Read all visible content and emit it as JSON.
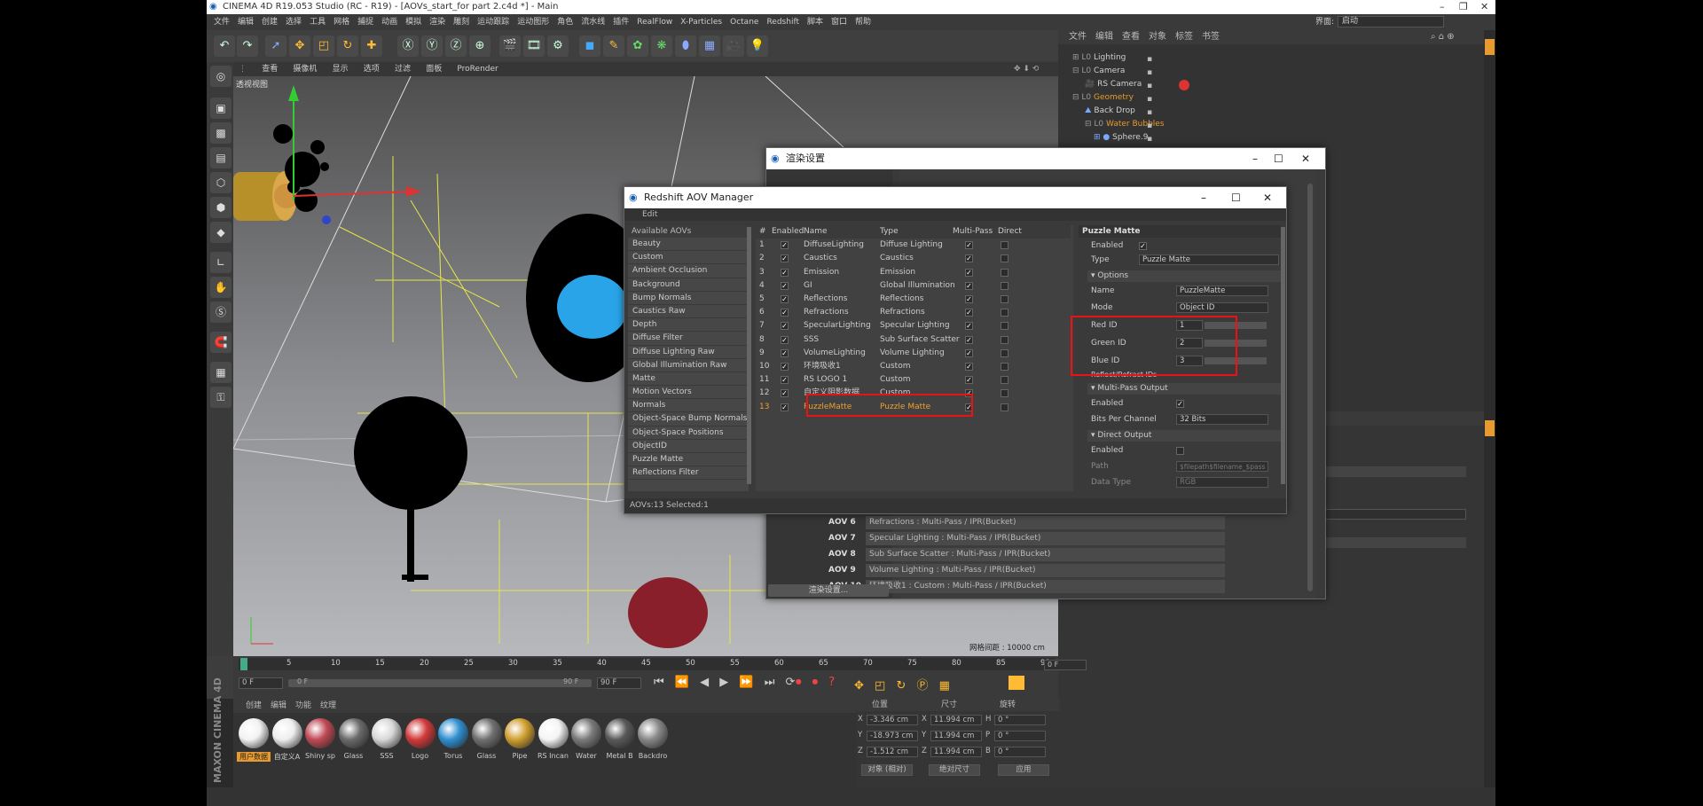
{
  "window": {
    "title": "CINEMA 4D R19.053 Studio (RC - R19) - [AOVs_start_for part 2.c4d *] - Main"
  },
  "menu": [
    "文件",
    "编辑",
    "创建",
    "选择",
    "工具",
    "网格",
    "捕捉",
    "动画",
    "模拟",
    "渲染",
    "雕刻",
    "运动跟踪",
    "运动图形",
    "角色",
    "流水线",
    "插件",
    "RealFlow",
    "X-Particles",
    "Octane",
    "Redshift",
    "脚本",
    "窗口",
    "帮助"
  ],
  "layout": {
    "label": "界面:",
    "value": "启动"
  },
  "viewport": {
    "menu": [
      "查看",
      "摄像机",
      "显示",
      "选项",
      "过滤",
      "面板",
      "ProRender"
    ],
    "label": "透视视图",
    "grid_distance": "网格间距 : 10000 cm"
  },
  "object_manager": {
    "menu": [
      "文件",
      "编辑",
      "查看",
      "对象",
      "标签",
      "书签"
    ],
    "objects": [
      {
        "name": "Lighting",
        "color": "#cfcfcf"
      },
      {
        "name": "Camera",
        "color": "#cfcfcf"
      },
      {
        "name": "RS Camera",
        "color": "#cfcfcf"
      },
      {
        "name": "Geometry",
        "color": "#e79a2f"
      },
      {
        "name": "Back Drop",
        "color": "#cfcfcf"
      },
      {
        "name": "Water Bubbles",
        "color": "#e79a2f"
      },
      {
        "name": "Sphere.9",
        "color": "#cfcfcf"
      }
    ]
  },
  "render_settings": {
    "title": "渲染设置",
    "button": "渲染设置...",
    "aovs": [
      {
        "id": "AOV 6",
        "text": "Refractions : Multi-Pass / IPR(Bucket)"
      },
      {
        "id": "AOV 7",
        "text": "Specular Lighting : Multi-Pass / IPR(Bucket)"
      },
      {
        "id": "AOV 8",
        "text": "Sub Surface Scatter : Multi-Pass / IPR(Bucket)"
      },
      {
        "id": "AOV 9",
        "text": "Volume Lighting : Multi-Pass / IPR(Bucket)"
      },
      {
        "id": "AOV 10",
        "text": "环境吸收1 : Custom : Multi-Pass / IPR(Bucket)"
      }
    ]
  },
  "aov_manager": {
    "title": "Redshift AOV Manager",
    "menu_edit": "Edit",
    "available_header": "Available AOVs",
    "available": [
      "Beauty",
      "Custom",
      "Ambient Occlusion",
      "Background",
      "Bump Normals",
      "Caustics Raw",
      "Depth",
      "Diffuse Filter",
      "Diffuse Lighting Raw",
      "Global Illumination Raw",
      "Matte",
      "Motion Vectors",
      "Normals",
      "Object-Space Bump Normals",
      "Object-Space Positions",
      "ObjectID",
      "Puzzle Matte",
      "Reflections Filter"
    ],
    "columns": {
      "num": "#",
      "enabled": "Enabled",
      "name": "Name",
      "type": "Type",
      "multipass": "Multi-Pass",
      "direct": "Direct"
    },
    "rows": [
      {
        "num": "1",
        "name": "DiffuseLighting",
        "type": "Diffuse Lighting"
      },
      {
        "num": "2",
        "name": "Caustics",
        "type": "Caustics"
      },
      {
        "num": "3",
        "name": "Emission",
        "type": "Emission"
      },
      {
        "num": "4",
        "name": "GI",
        "type": "Global Illumination"
      },
      {
        "num": "5",
        "name": "Reflections",
        "type": "Reflections"
      },
      {
        "num": "6",
        "name": "Refractions",
        "type": "Refractions"
      },
      {
        "num": "7",
        "name": "SpecularLighting",
        "type": "Specular Lighting"
      },
      {
        "num": "8",
        "name": "SSS",
        "type": "Sub Surface Scatter"
      },
      {
        "num": "9",
        "name": "VolumeLighting",
        "type": "Volume Lighting"
      },
      {
        "num": "10",
        "name": "环境吸收1",
        "type": "Custom"
      },
      {
        "num": "11",
        "name": "RS LOGO 1",
        "type": "Custom"
      },
      {
        "num": "12",
        "name": "自定义阴影数据",
        "type": "Custom"
      },
      {
        "num": "13",
        "name": "PuzzleMatte",
        "type": "Puzzle Matte"
      }
    ],
    "status": "AOVs:13 Selected:1",
    "props": {
      "header": "Puzzle Matte",
      "enabled_label": "Enabled",
      "type_label": "Type",
      "type_value": "Puzzle Matte",
      "options_header": "Options",
      "name_label": "Name",
      "name_value": "PuzzleMatte",
      "mode_label": "Mode",
      "mode_value": "Object ID",
      "red_label": "Red ID",
      "red_value": "1",
      "green_label": "Green ID",
      "green_value": "2",
      "blue_label": "Blue ID",
      "blue_value": "3",
      "reflect_label": "Reflect/Refract IDs",
      "multipass_header": "Multi-Pass Output",
      "mp_enabled_label": "Enabled",
      "bits_label": "Bits Per Channel",
      "bits_value": "32 Bits",
      "direct_header": "Direct Output",
      "do_enabled_label": "Enabled",
      "path_label": "Path",
      "path_value": "$filepath$filename_$pass",
      "datatype_label": "Data Type",
      "datatype_value": "RGB"
    }
  },
  "timeline": {
    "ticks": [
      "0",
      "5",
      "10",
      "15",
      "20",
      "25",
      "30",
      "35",
      "40",
      "45",
      "50",
      "55",
      "60",
      "65",
      "70",
      "75",
      "80",
      "85",
      "90"
    ],
    "current": "0 F",
    "start": "0 F",
    "end": "90 F",
    "end2": "90 F",
    "frame_right": "0 F"
  },
  "materials": {
    "menu": [
      "创建",
      "编辑",
      "功能",
      "纹理"
    ],
    "items": [
      {
        "label": "用户数据",
        "color": "#f2f2f2"
      },
      {
        "label": "自定义A",
        "color": "#eeeeee"
      },
      {
        "label": "Shiny sp",
        "color": "#c04a55"
      },
      {
        "label": "Glass",
        "color": "#6a6a6a"
      },
      {
        "label": "SSS",
        "color": "#d8d8d8"
      },
      {
        "label": "Logo",
        "color": "#d23a3a"
      },
      {
        "label": "Torus",
        "color": "#2f8fd0"
      },
      {
        "label": "Glass",
        "color": "#707070"
      },
      {
        "label": "Pipe",
        "color": "#d0a030"
      },
      {
        "label": "RS Incan",
        "color": "#f4f4f4"
      },
      {
        "label": "Water",
        "color": "#7a7a7a"
      },
      {
        "label": "Metal B",
        "color": "#5a5a5a"
      },
      {
        "label": "Backdro",
        "color": "#888888"
      }
    ]
  },
  "coords": {
    "headers": [
      "位置",
      "尺寸",
      "旋转"
    ],
    "rows": [
      {
        "axis": "X",
        "pos": "-3.346 cm",
        "size_axis": "X",
        "size": "11.994 cm",
        "rot_axis": "H",
        "rot": "0 °"
      },
      {
        "axis": "Y",
        "pos": "-18.973 cm",
        "size_axis": "Y",
        "size": "11.994 cm",
        "rot_axis": "P",
        "rot": "0 °"
      },
      {
        "axis": "Z",
        "pos": "-1.512 cm",
        "size_axis": "Z",
        "size": "11.994 cm",
        "rot_axis": "B",
        "rot": "0 °"
      }
    ],
    "mode": "对象 (相对)",
    "size_mode": "绝对尺寸",
    "apply": "应用"
  },
  "brand": "MAXON CINEMA 4D"
}
